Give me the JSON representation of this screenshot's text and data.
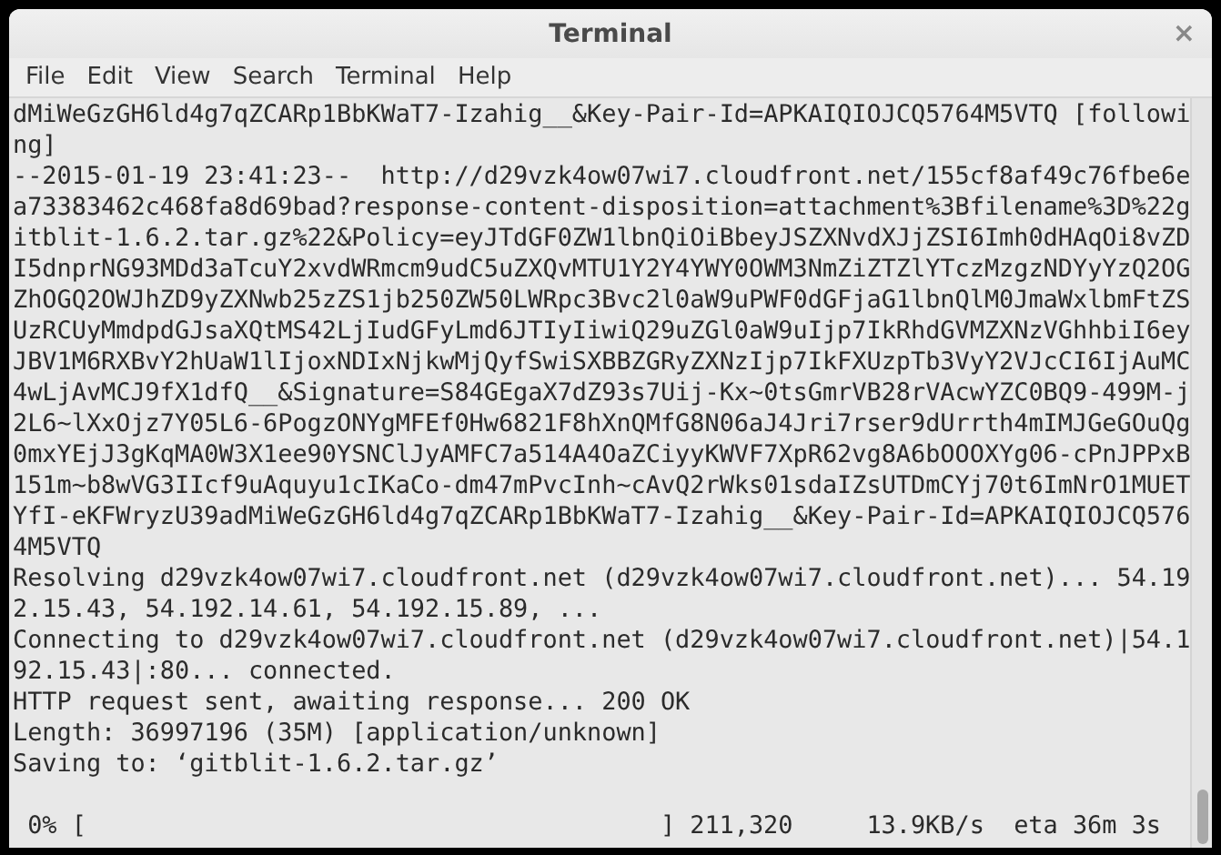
{
  "window": {
    "title": "Terminal",
    "close": "×"
  },
  "menu": [
    "File",
    "Edit",
    "View",
    "Search",
    "Terminal",
    "Help"
  ],
  "terminal": {
    "lines": [
      "dMiWeGzGH6ld4g7qZCARp1BbKWaT7-Izahig__&Key-Pair-Id=APKAIQIOJCQ5764M5VTQ [followi",
      "ng]",
      "--2015-01-19 23:41:23--  http://d29vzk4ow07wi7.cloudfront.net/155cf8af49c76fbe6e",
      "a73383462c468fa8d69bad?response-content-disposition=attachment%3Bfilename%3D%22g",
      "itblit-1.6.2.tar.gz%22&Policy=eyJTdGF0ZW1lbnQiOiBbeyJSZXNvdXJjZSI6Imh0dHAqOi8vZD",
      "I5dnprNG93MDd3aTcuY2xvdWRmcm9udC5uZXQvMTU1Y2Y4YWY0OWM3NmZiZTZlYTczMzgzNDYyYzQ2OG",
      "ZhOGQ2OWJhZD9yZXNwb25zZS1jb250ZW50LWRpc3Bvc2l0aW9uPWF0dGFjaG1lbnQlM0JmaWxlbmFtZS",
      "UzRCUyMmdpdGJsaXQtMS42LjIudGFyLmd6JTIyIiwiQ29uZGl0aW9uIjp7IkRhdGVMZXNzVGhhbiI6ey",
      "JBV1M6RXBvY2hUaW1lIjoxNDIxNjkwMjQyfSwiSXBBZGRyZXNzIjp7IkFXUzpTb3VyY2VJcCI6IjAuMC",
      "4wLjAvMCJ9fX1dfQ__&Signature=S84GEgaX7dZ93s7Uij-Kx~0tsGmrVB28rVAcwYZC0BQ9-499M-j",
      "2L6~lXxOjz7Y05L6-6PogzONYgMFEf0Hw6821F8hXnQMfG8N06aJ4Jri7rser9dUrrth4mIMJGeGOuQg",
      "0mxYEjJ3gKqMA0W3X1ee90YSNClJyAMFC7a514A4OaZCiyyKWVF7XpR62vg8A6bOOOXYg06-cPnJPPxB",
      "151m~b8wVG3IIcf9uAquyu1cIKaCo-dm47mPvcInh~cAvQ2rWks01sdaIZsUTDmCYj70t6ImNrO1MUET",
      "YfI-eKFWryzU39adMiWeGzGH6ld4g7qZCARp1BbKWaT7-Izahig__&Key-Pair-Id=APKAIQIOJCQ576",
      "4M5VTQ",
      "Resolving d29vzk4ow07wi7.cloudfront.net (d29vzk4ow07wi7.cloudfront.net)... 54.19",
      "2.15.43, 54.192.14.61, 54.192.15.89, ...",
      "Connecting to d29vzk4ow07wi7.cloudfront.net (d29vzk4ow07wi7.cloudfront.net)|54.1",
      "92.15.43|:80... connected.",
      "HTTP request sent, awaiting response... 200 OK",
      "Length: 36997196 (35M) [application/unknown]",
      "Saving to: ‘gitblit-1.6.2.tar.gz’"
    ],
    "progress": {
      "percent": "0%",
      "bar_open": "[",
      "bar_close": "]",
      "received": "211,320",
      "speed": "13.9KB/s",
      "eta": "eta 36m 3s"
    }
  }
}
